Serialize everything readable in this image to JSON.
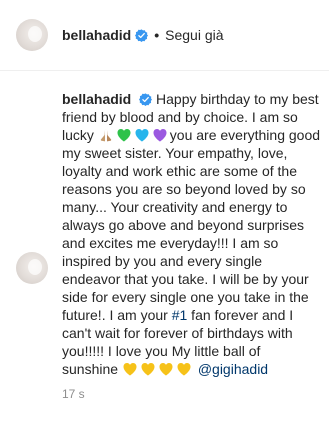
{
  "header": {
    "username": "bellahadid",
    "separator": "•",
    "follow_label": "Segui già"
  },
  "comment": {
    "username": "bellahadid",
    "text_part1": "Happy birthday to my best friend by blood and by choice. I am so lucky ",
    "text_part2": "you are everything good my sweet sister. Your empathy, love, loyalty and work ethic are some of the reasons you are so beyond loved by so many... Your creativity and energy to always go above and beyond surprises and excites me everyday!!! I am so inspired by you and every single endeavor that you take. I will be by your side for every single one you take in the future!. I am your ",
    "highlight": "#1",
    "text_part3": " fan forever and I can't wait for forever of birthdays with you!!!!! I love you My little ball of sunshine ",
    "mention": "@gigihadid",
    "time_label": "17 s"
  },
  "emojis": {
    "row1": [
      "folded-hands-icon",
      "green-heart-icon",
      "blue-heart-icon",
      "purple-heart-icon"
    ],
    "row2": [
      "yellow-heart-icon",
      "yellow-heart-icon",
      "yellow-heart-icon",
      "yellow-heart-icon"
    ]
  },
  "colors": {
    "verified": "#3897f0",
    "green_heart": "#2ec24a",
    "blue_heart": "#27b5ec",
    "purple_heart": "#9b59e0",
    "yellow_heart": "#f6c219",
    "folded_hands": "#c49a6c",
    "link": "#00376b"
  }
}
